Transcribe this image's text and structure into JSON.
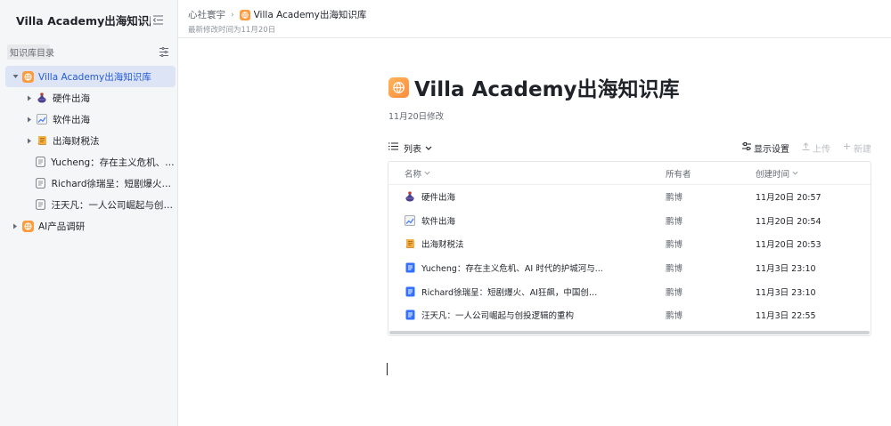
{
  "sidebar": {
    "title": "Villa Academy出海知识库",
    "section_label": "知识库目录",
    "items": [
      {
        "label": "Villa Academy出海知识库",
        "icon": "globe-icon",
        "level": 0,
        "caret": "expanded",
        "active": true
      },
      {
        "label": "硬件出海",
        "icon": "potion-icon",
        "level": 1,
        "caret": "collapsed"
      },
      {
        "label": "软件出海",
        "icon": "chart-icon",
        "level": 1,
        "caret": "collapsed"
      },
      {
        "label": "出海财税法",
        "icon": "scroll-icon",
        "level": 1,
        "caret": "collapsed"
      },
      {
        "label": "Yucheng：存在主义危机、AI 时...",
        "icon": "doc-icon",
        "level": 1,
        "caret": "none"
      },
      {
        "label": "Richard徐瑞呈：短剧爆火、AI...",
        "icon": "doc-icon",
        "level": 1,
        "caret": "none"
      },
      {
        "label": "汪天凡：一人公司崛起与创投逻...",
        "icon": "doc-icon",
        "level": 1,
        "caret": "none"
      },
      {
        "label": "AI产品调研",
        "icon": "globe-icon",
        "level": 0,
        "caret": "collapsed"
      }
    ]
  },
  "header": {
    "breadcrumb_root": "心社寰宇",
    "breadcrumb_current": "Villa Academy出海知识库",
    "modified": "最新修改时间为11月20日"
  },
  "main": {
    "title": "Villa Academy出海知识库",
    "date": "11月20日修改",
    "view_label": "列表",
    "display_settings": "显示设置",
    "upload": "上传",
    "new": "新建",
    "columns": [
      "名称",
      "所有者",
      "创建时间"
    ],
    "rows": [
      {
        "icon": "potion-icon",
        "name": "硬件出海",
        "owner": "鹏博",
        "created": "11月20日 20:57"
      },
      {
        "icon": "chart-icon",
        "name": "软件出海",
        "owner": "鹏博",
        "created": "11月20日 20:54"
      },
      {
        "icon": "scroll-icon",
        "name": "出海财税法",
        "owner": "鹏博",
        "created": "11月20日 20:53"
      },
      {
        "icon": "doc-icon",
        "name": "Yucheng：存在主义危机、AI 时代的护城河与...",
        "owner": "鹏博",
        "created": "11月3日 23:10"
      },
      {
        "icon": "doc-icon",
        "name": "Richard徐瑞呈：短剧爆火、AI狂飙，中国创始...",
        "owner": "鹏博",
        "created": "11月3日 23:10"
      },
      {
        "icon": "doc-icon",
        "name": "汪天凡：一人公司崛起与创投逻辑的重构",
        "owner": "鹏博",
        "created": "11月3日 22:55"
      }
    ]
  },
  "colors": {
    "accent": "#245bdb",
    "active_bg": "#dde4f6",
    "doc_icon": "#3370ff",
    "globe_icon": "#ff9a3d"
  }
}
